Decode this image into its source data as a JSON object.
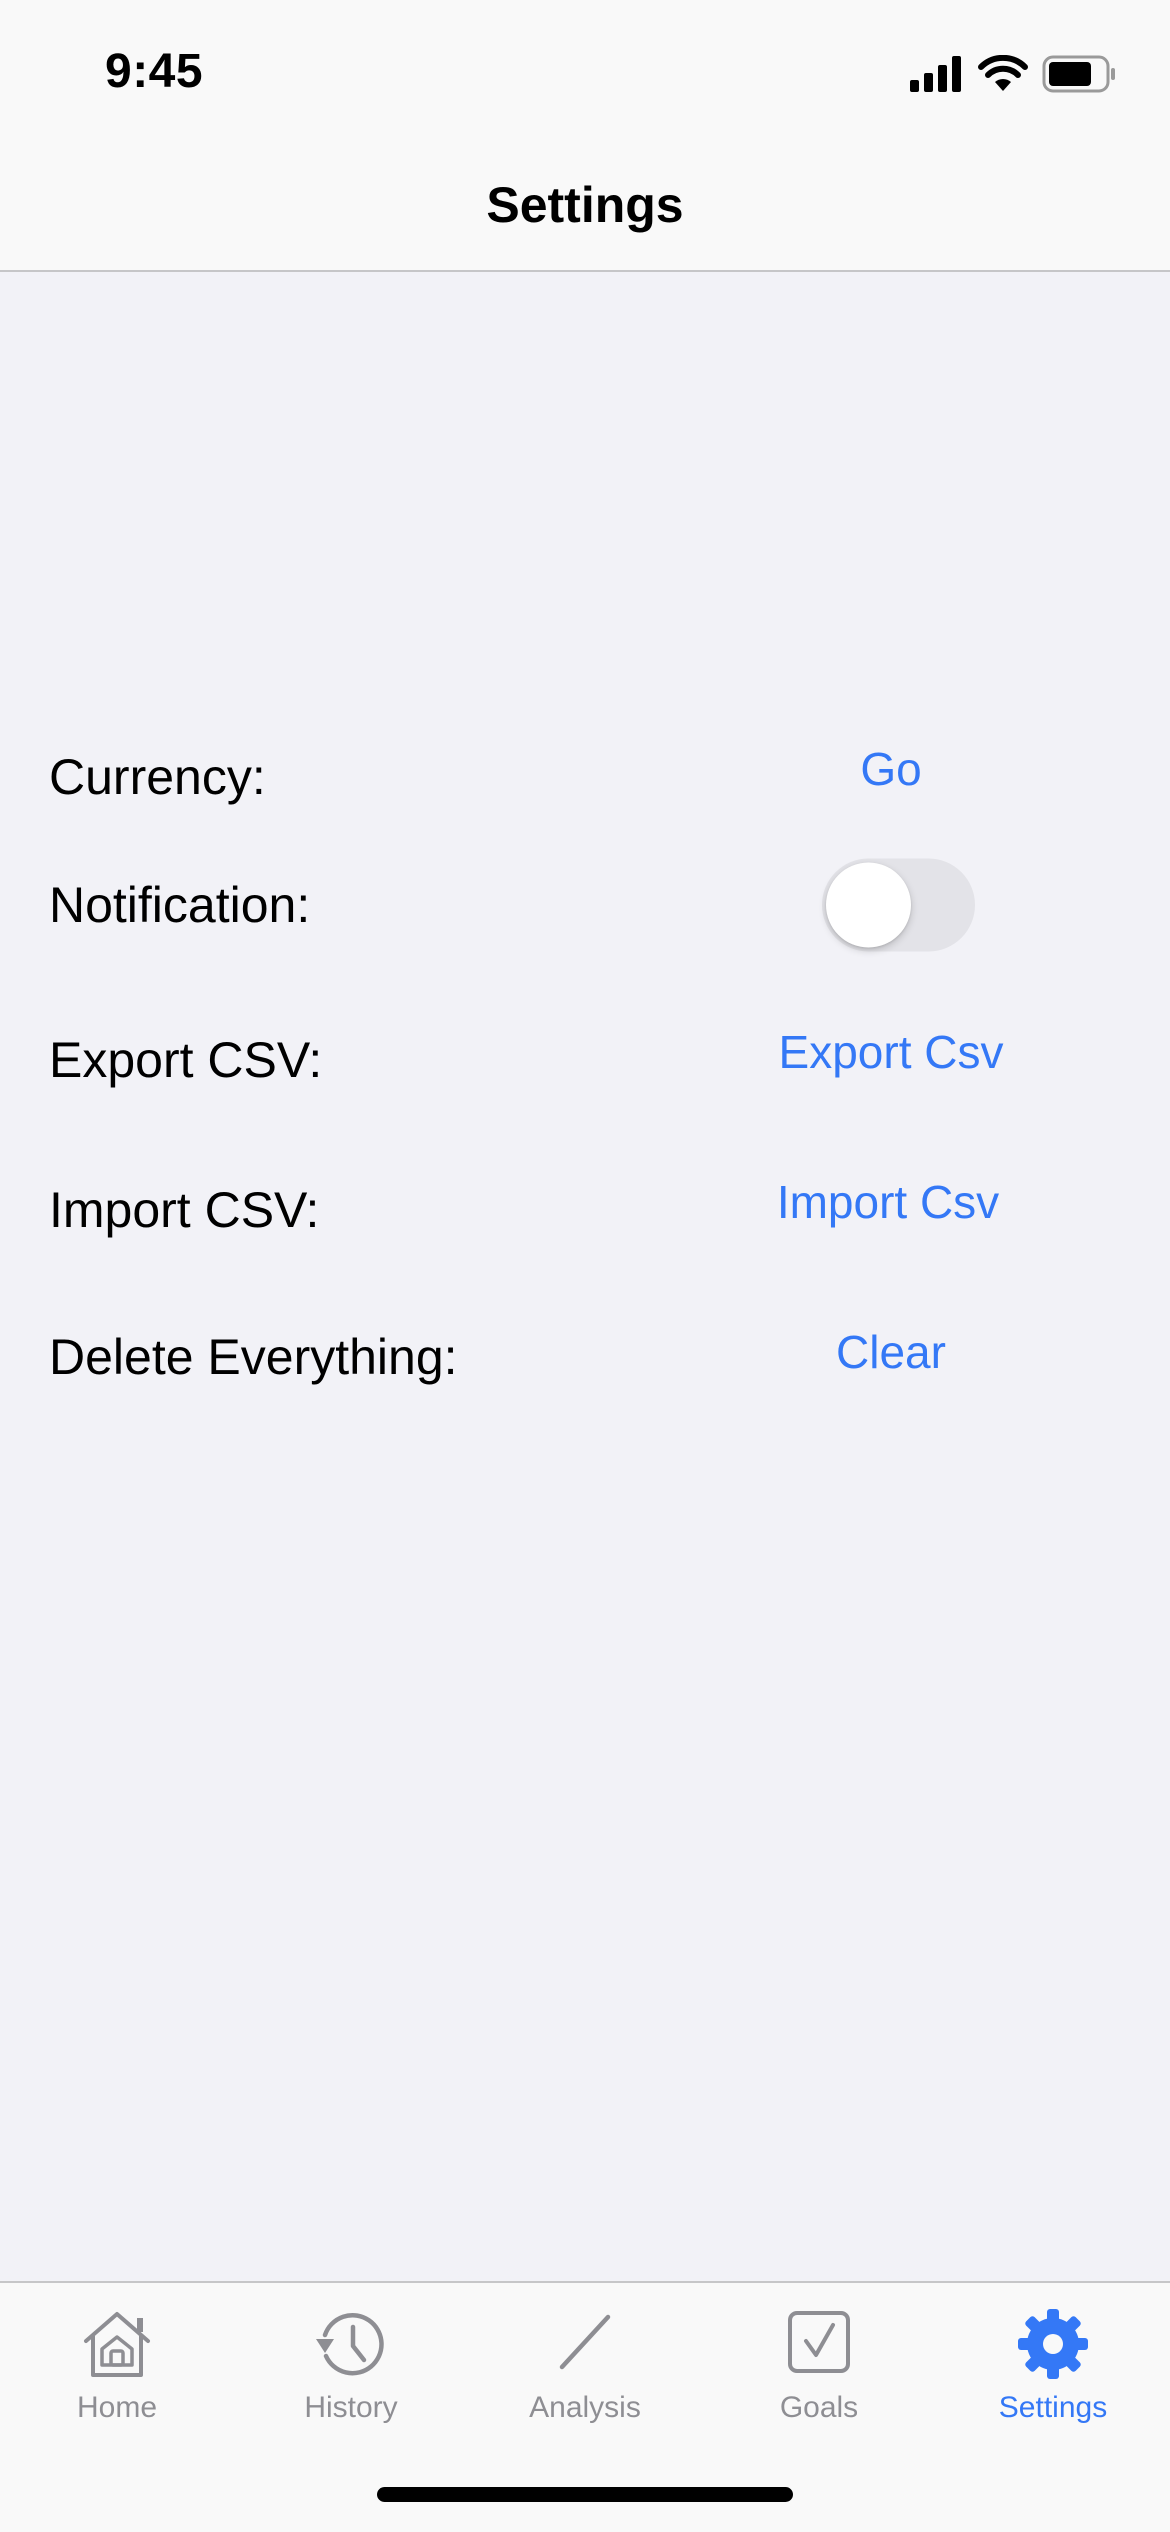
{
  "status_bar": {
    "time": "9:45",
    "icons": [
      "cellular-signal-icon",
      "wifi-icon",
      "battery-icon"
    ]
  },
  "nav": {
    "title": "Settings"
  },
  "settings": {
    "currency": {
      "label": "Currency:",
      "action": "Go"
    },
    "notification": {
      "label": "Notification:",
      "enabled": false
    },
    "export": {
      "label": "Export CSV:",
      "action": "Export Csv"
    },
    "import": {
      "label": "Import CSV:",
      "action": "Import Csv"
    },
    "delete": {
      "label": "Delete Everything:",
      "action": "Clear"
    }
  },
  "tabs": [
    {
      "label": "Home",
      "icon": "home-icon",
      "active": false
    },
    {
      "label": "History",
      "icon": "history-icon",
      "active": false
    },
    {
      "label": "Analysis",
      "icon": "analysis-icon",
      "active": false
    },
    {
      "label": "Goals",
      "icon": "goals-checkbox-icon",
      "active": false
    },
    {
      "label": "Settings",
      "icon": "gear-icon",
      "active": true
    }
  ],
  "colors": {
    "accent": "#3478f6",
    "background": "#f2f2f7",
    "bar_background": "#f9f9f9",
    "inactive_tab": "#8e8e93",
    "toggle_off": "#e3e3e8"
  }
}
